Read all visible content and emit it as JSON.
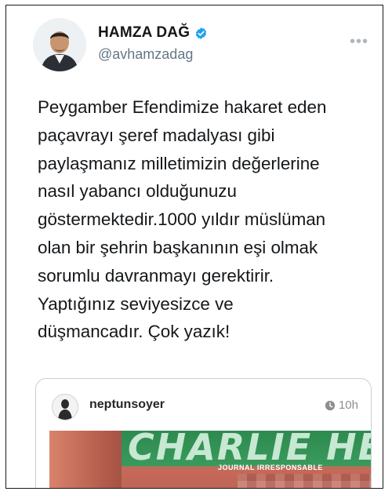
{
  "tweet": {
    "author_name": "HAMZA DAĞ",
    "handle": "@avhamzadag",
    "more_label": "•••",
    "text_lines": [
      "Peygamber Efendimize hakaret eden",
      "paçavrayı şeref madalyası gibi",
      "paylaşmanız milletimizin değerlerine",
      "nasıl yabancı olduğunuzu",
      "göstermektedir.1000 yıldır müslüman",
      "olan bir şehrin başkanının eşi olmak",
      "sorumlu davranmayı gerektirir.",
      "Yaptığınız seviyesizce ve",
      "düşmancadır. Çok yazık!"
    ]
  },
  "embedded_post": {
    "username": "neptunsoyer",
    "time": "10h",
    "cover_title": "CHARLIE HEBD",
    "cover_subtitle": "JOURNAL IRRESPONSABLE"
  },
  "icons": {
    "verified": "verified-badge-icon",
    "more": "more-options-icon",
    "clock": "clock-icon"
  },
  "colors": {
    "verified_blue": "#1da1f2",
    "handle_gray": "#657786",
    "text": "#14171a"
  }
}
